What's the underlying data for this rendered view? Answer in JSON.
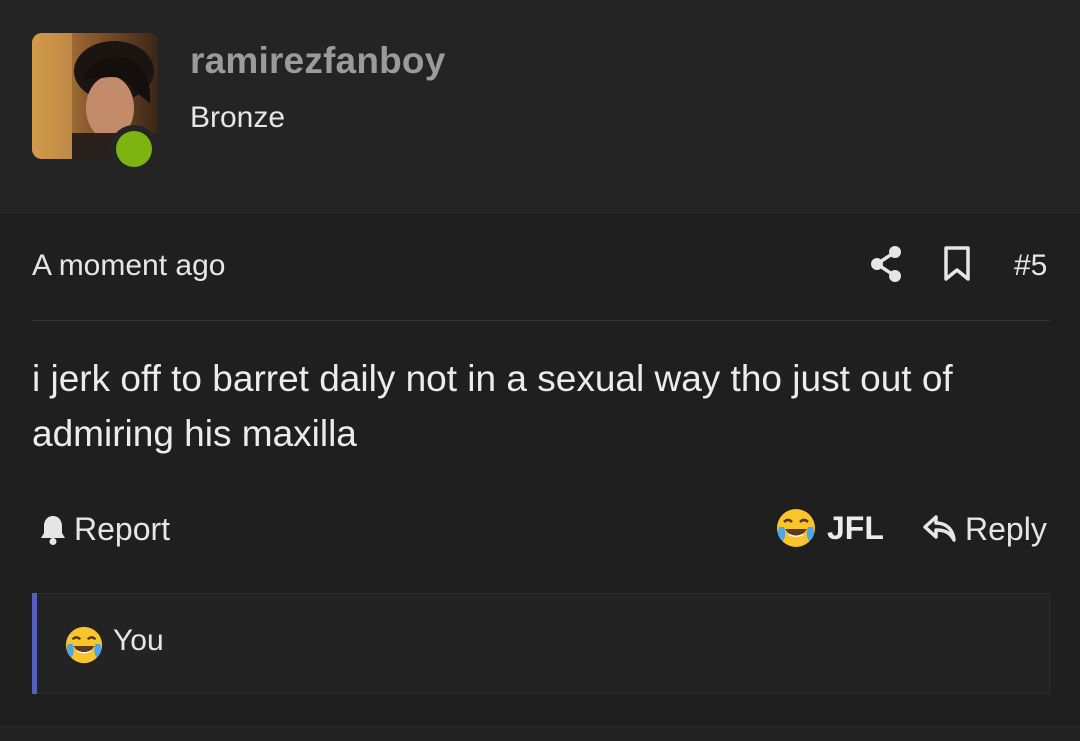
{
  "user": {
    "name": "ramirezfanboy",
    "rank": "Bronze",
    "online": true
  },
  "post": {
    "timestamp": "A moment ago",
    "number": "#5",
    "body": "i jerk off to barret daily not in a sexual way tho just out of admiring his maxilla"
  },
  "actions": {
    "report_label": "Report",
    "reaction_label": "JFL",
    "reply_label": "Reply"
  },
  "reactions": {
    "summary": "You"
  },
  "icons": {
    "share": "share-icon",
    "bookmark": "bookmark-icon",
    "report": "bell-icon",
    "reaction": "crying-laughing-emoji-icon",
    "reply": "reply-arrow-icon"
  },
  "colors": {
    "background": "#1f1f1f",
    "header_background": "#242424",
    "username": "#9b9b9b",
    "online": "#7db411",
    "reaction_accent": "#5560c0"
  }
}
